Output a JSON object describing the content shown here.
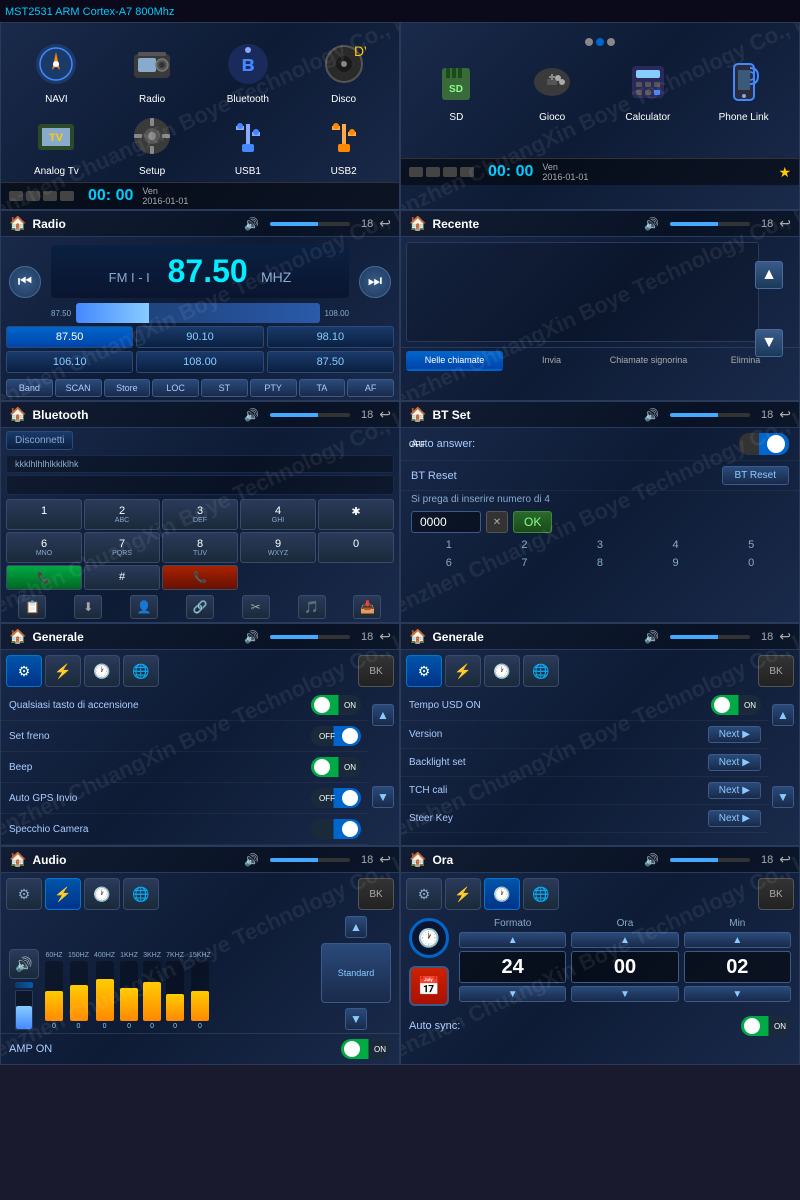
{
  "header": {
    "title": "MST2531 ARM Cortex-A7 800Mhz"
  },
  "panel1": {
    "apps": [
      {
        "label": "NAVI",
        "icon": "🧭"
      },
      {
        "label": "Radio",
        "icon": "📻"
      },
      {
        "label": "Bluetooth",
        "icon": "🎧"
      },
      {
        "label": "Disco",
        "icon": "💿"
      },
      {
        "label": "Analog Tv",
        "icon": "📺"
      },
      {
        "label": "Setup",
        "icon": "⚙️"
      },
      {
        "label": "USB1",
        "icon": "🔌"
      },
      {
        "label": "USB2",
        "icon": "🔌"
      }
    ],
    "statusbar": {
      "time": "00: 00",
      "day": "Ven",
      "date": "2016-01-01"
    }
  },
  "panel2": {
    "apps": [
      {
        "label": "SD",
        "icon": "💾"
      },
      {
        "label": "Gioco",
        "icon": "🎮"
      },
      {
        "label": "Calculator",
        "icon": "🧮"
      },
      {
        "label": "Phone Link",
        "icon": "📱"
      }
    ],
    "statusbar": {
      "time": "00: 00",
      "day": "Ven",
      "date": "2016-01-01"
    }
  },
  "radio": {
    "title": "Radio",
    "band": "FM I - I",
    "freq": "87.50",
    "unit": "MHZ",
    "bar_min": "87.50",
    "bar_max": "108.00",
    "presets": [
      "87.50",
      "90.10",
      "98.10",
      "106.10",
      "108.00",
      "87.50"
    ],
    "controls": [
      "Band",
      "SCAN",
      "Store",
      "LOC",
      "ST",
      "PTY",
      "TA",
      "AF"
    ],
    "vol": 18
  },
  "recente": {
    "title": "Recente",
    "vol": 18,
    "tabs": [
      "Nelle chiamate",
      "Invia",
      "Chiamate signorina",
      "Elimina"
    ]
  },
  "bluetooth": {
    "title": "Bluetooth",
    "vol": 18,
    "disconnect_label": "Disconnetti",
    "device_id": "kkklhlhlhlkklklhk",
    "keypad": [
      [
        "1",
        "2\nABC",
        "3\nDEF",
        "4\nGHI",
        "✱"
      ],
      [
        "6\nMNO",
        "7\nPQRS",
        "8\nTUV",
        "9\nWXYZ",
        "0"
      ],
      [
        "#"
      ]
    ],
    "keys_row1": [
      "1",
      "2",
      "3",
      "4",
      "✱"
    ],
    "keys_row2": [
      "6",
      "7",
      "8",
      "9",
      "0"
    ],
    "keys_sub1": [
      "",
      "ABC",
      "DEF",
      "GHI",
      ""
    ],
    "keys_sub2": [
      "MNO",
      "PQRS",
      "TUV",
      "WXYZ",
      ""
    ],
    "call_green": "📞",
    "call_red": "📞",
    "actions": [
      "📋",
      "⬇",
      "👤",
      "🔗",
      "✂",
      "🎵",
      "📥"
    ]
  },
  "bt_set": {
    "title": "BT Set",
    "vol": 18,
    "auto_answer_label": "Auto answer:",
    "auto_answer_val": "OFF",
    "bt_reset_label": "BT Reset",
    "bt_reset_btn": "BT Reset",
    "hint": "Si prega di inserire numero di 4",
    "pin": "0000",
    "ok_label": "OK",
    "num_row": [
      "1",
      "2",
      "3",
      "4",
      "5"
    ],
    "num_row2": [
      "6",
      "7",
      "8",
      "9",
      "0"
    ]
  },
  "generale1": {
    "title": "Generale",
    "vol": 18,
    "rows": [
      {
        "label": "Qualsiasi tasto di accensione",
        "val": "ON",
        "type": "toggle_on"
      },
      {
        "label": "Set freno",
        "val": "OFF",
        "type": "toggle_off"
      },
      {
        "label": "Beep",
        "val": "ON",
        "type": "toggle_on"
      },
      {
        "label": "Auto GPS Invio",
        "val": "OFF",
        "type": "toggle_off"
      },
      {
        "label": "Specchio Camera",
        "val": "",
        "type": "toggle_off"
      }
    ]
  },
  "generale2": {
    "title": "Generale",
    "vol": 18,
    "rows": [
      {
        "label": "Tempo USD ON",
        "val": "ON",
        "type": "toggle_on"
      },
      {
        "label": "Version",
        "val": "Next",
        "type": "next"
      },
      {
        "label": "Backlight set",
        "val": "Next",
        "type": "next"
      },
      {
        "label": "TCH cali",
        "val": "Next",
        "type": "next"
      },
      {
        "label": "Steer Key",
        "val": "Next",
        "type": "next"
      }
    ]
  },
  "audio": {
    "title": "Audio",
    "vol": 18,
    "eq_labels": [
      "60HZ",
      "150HZ",
      "400HZ",
      "1KHZ",
      "3KHZ",
      "7KHZ",
      "15KHZ"
    ],
    "eq_vals": [
      50,
      60,
      70,
      55,
      65,
      45,
      50
    ],
    "preset_label": "Standard",
    "amp_label": "AMP ON",
    "amp_val": "ON"
  },
  "ora": {
    "title": "Ora",
    "vol": 18,
    "formato_label": "Formato",
    "ora_label": "Ora",
    "min_label": "Min",
    "formato_val": "24",
    "ora_val": "00",
    "min_val": "02",
    "auto_sync_label": "Auto sync:",
    "auto_sync_val": "ON"
  },
  "labels": {
    "bk": "BK",
    "next_arrow": "▶"
  }
}
